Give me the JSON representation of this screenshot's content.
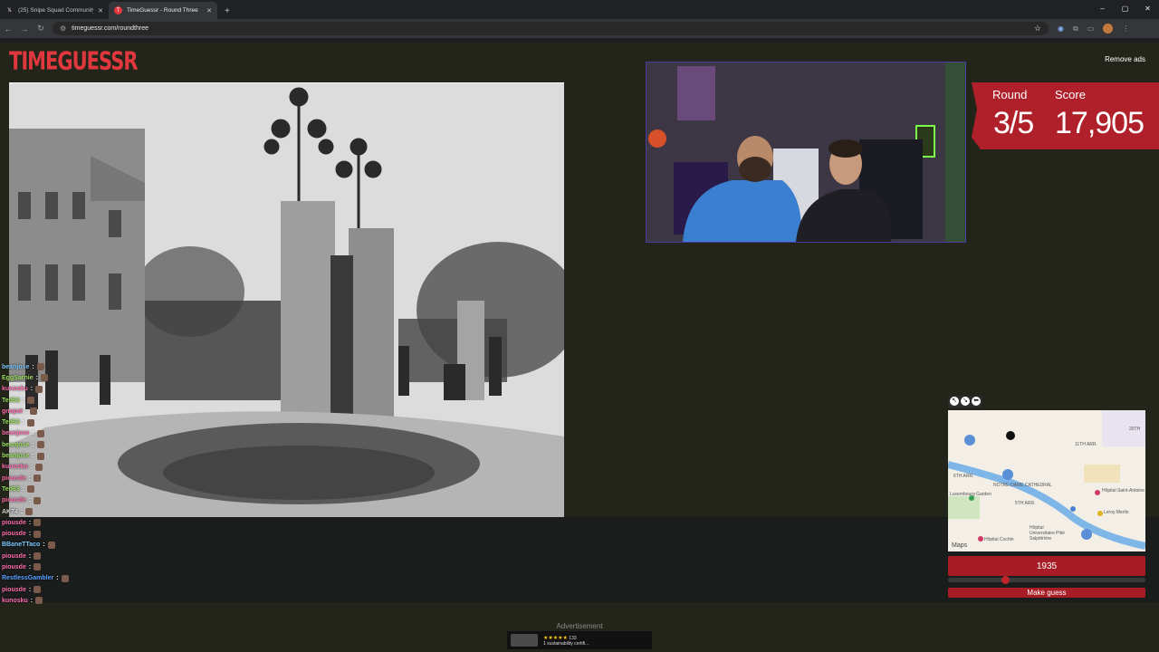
{
  "browser": {
    "tabs": [
      {
        "title": "(25) Snipe Squad Community /",
        "favicon": "x-logo-icon",
        "active": false
      },
      {
        "title": "TimeGuessr - Round Three",
        "favicon": "timeguessr-icon",
        "active": true
      }
    ],
    "new_tab": "+",
    "url": "timeguessr.com/roundthree",
    "window_controls": [
      "–",
      "▢",
      "✕"
    ]
  },
  "page": {
    "logo": "TIMEGUESSR",
    "remove_ads": "Remove ads",
    "round_label": "Round",
    "round_value": "3/5",
    "score_label": "Score",
    "score_value": "17,905",
    "year": "1935",
    "year_fraction": 0.29,
    "make_guess": "Make guess",
    "advertisement": "Advertisement",
    "ad": {
      "stars": "★★★★★",
      "rating": "133",
      "text": "1 sustainability certifi..."
    }
  },
  "map": {
    "labels": [
      "11TH ARR.",
      "6TH ARR.",
      "NOTRE-DAME CATHEDRAL",
      "5TH ARR.",
      "Luxembourg Garden",
      "Hôpital Saint-Antoine",
      "Leroy Merlin",
      "Hôpital Universitaire Pitié Salpêtrière",
      "Hôpital Cochin",
      "20TH",
      "Maps"
    ]
  },
  "chat": [
    {
      "user": "beanjose",
      "color": "#7ec8ff"
    },
    {
      "user": "EggSarnie",
      "color": "#9be15d"
    },
    {
      "user": "kunosku",
      "color": "#ff6fae"
    },
    {
      "user": "Ted63",
      "color": "#9be15d"
    },
    {
      "user": "gnapat",
      "color": "#ff6fae"
    },
    {
      "user": "Ted63",
      "color": "#9be15d"
    },
    {
      "user": "beanjose",
      "color": "#ff6fae"
    },
    {
      "user": "beanjose",
      "color": "#9be15d"
    },
    {
      "user": "beanjose",
      "color": "#9be15d"
    },
    {
      "user": "kunosku",
      "color": "#ff6fae"
    },
    {
      "user": "piousde",
      "color": "#ff6fae"
    },
    {
      "user": "Ted63",
      "color": "#9be15d"
    },
    {
      "user": "piousde",
      "color": "#ff6fae"
    },
    {
      "user": "AK74",
      "color": "#d8d8d8"
    },
    {
      "user": "piousde",
      "color": "#ff6fae"
    },
    {
      "user": "piousde",
      "color": "#ff6fae"
    },
    {
      "user": "BBaneTTaco",
      "color": "#7ec8ff"
    },
    {
      "user": "piousde",
      "color": "#ff6fae"
    },
    {
      "user": "piousde",
      "color": "#ff6fae"
    },
    {
      "user": "RestlessGambler",
      "color": "#5aa0ff"
    },
    {
      "user": "piousde",
      "color": "#ff6fae"
    },
    {
      "user": "kunosku",
      "color": "#ff6fae"
    }
  ]
}
